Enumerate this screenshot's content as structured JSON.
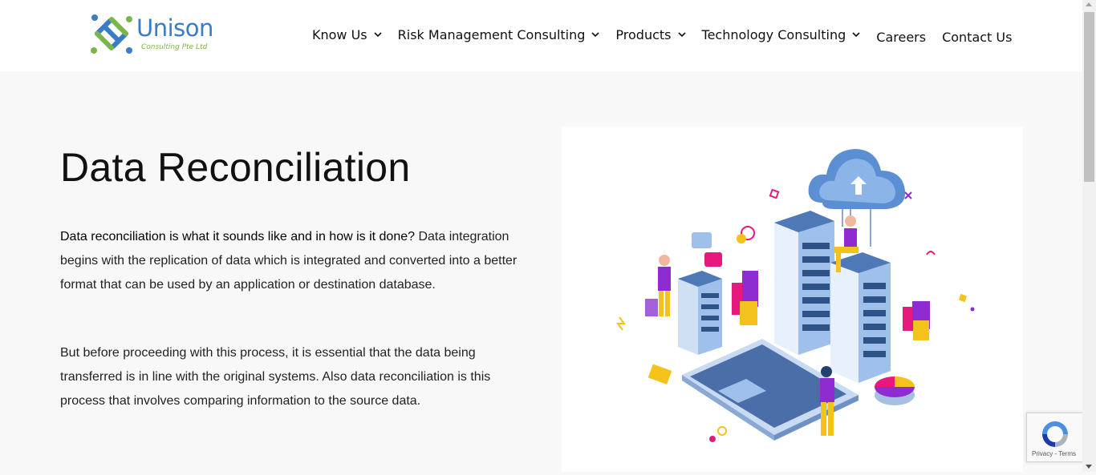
{
  "brand": {
    "name": "Unison",
    "tagline": "Consulting Pte Ltd"
  },
  "nav": {
    "items": [
      {
        "label": "Know Us",
        "dropdown": true
      },
      {
        "label": "Risk Management Consulting",
        "dropdown": true
      },
      {
        "label": "Products",
        "dropdown": true
      },
      {
        "label": "Technology Consulting",
        "dropdown": true
      },
      {
        "label": "Careers",
        "dropdown": false
      },
      {
        "label": "Contact Us",
        "dropdown": false
      }
    ]
  },
  "main": {
    "title": "Data Reconciliation",
    "intro_bold": "Data reconciliation is what it sounds like and in how is it done?",
    "intro_rest": " Data integration begins with the replication of data which is integrated and converted into a better format that can be used by an application or destination database.",
    "paragraph2": "But before proceeding with this process, it is essential that the data being transferred is in line with the original systems. Also data reconciliation is this process that involves comparing information to the source data."
  },
  "recaptcha": {
    "privacy": "Privacy",
    "separator": " - ",
    "terms": "Terms"
  },
  "colors": {
    "brand_blue": "#3a7cc6",
    "brand_green": "#7ab648",
    "page_bg": "#f8f8f8",
    "header_bg": "#ffffff"
  },
  "icons": {
    "dropdown": "chevron-down-icon",
    "recaptcha": "recaptcha-icon"
  }
}
